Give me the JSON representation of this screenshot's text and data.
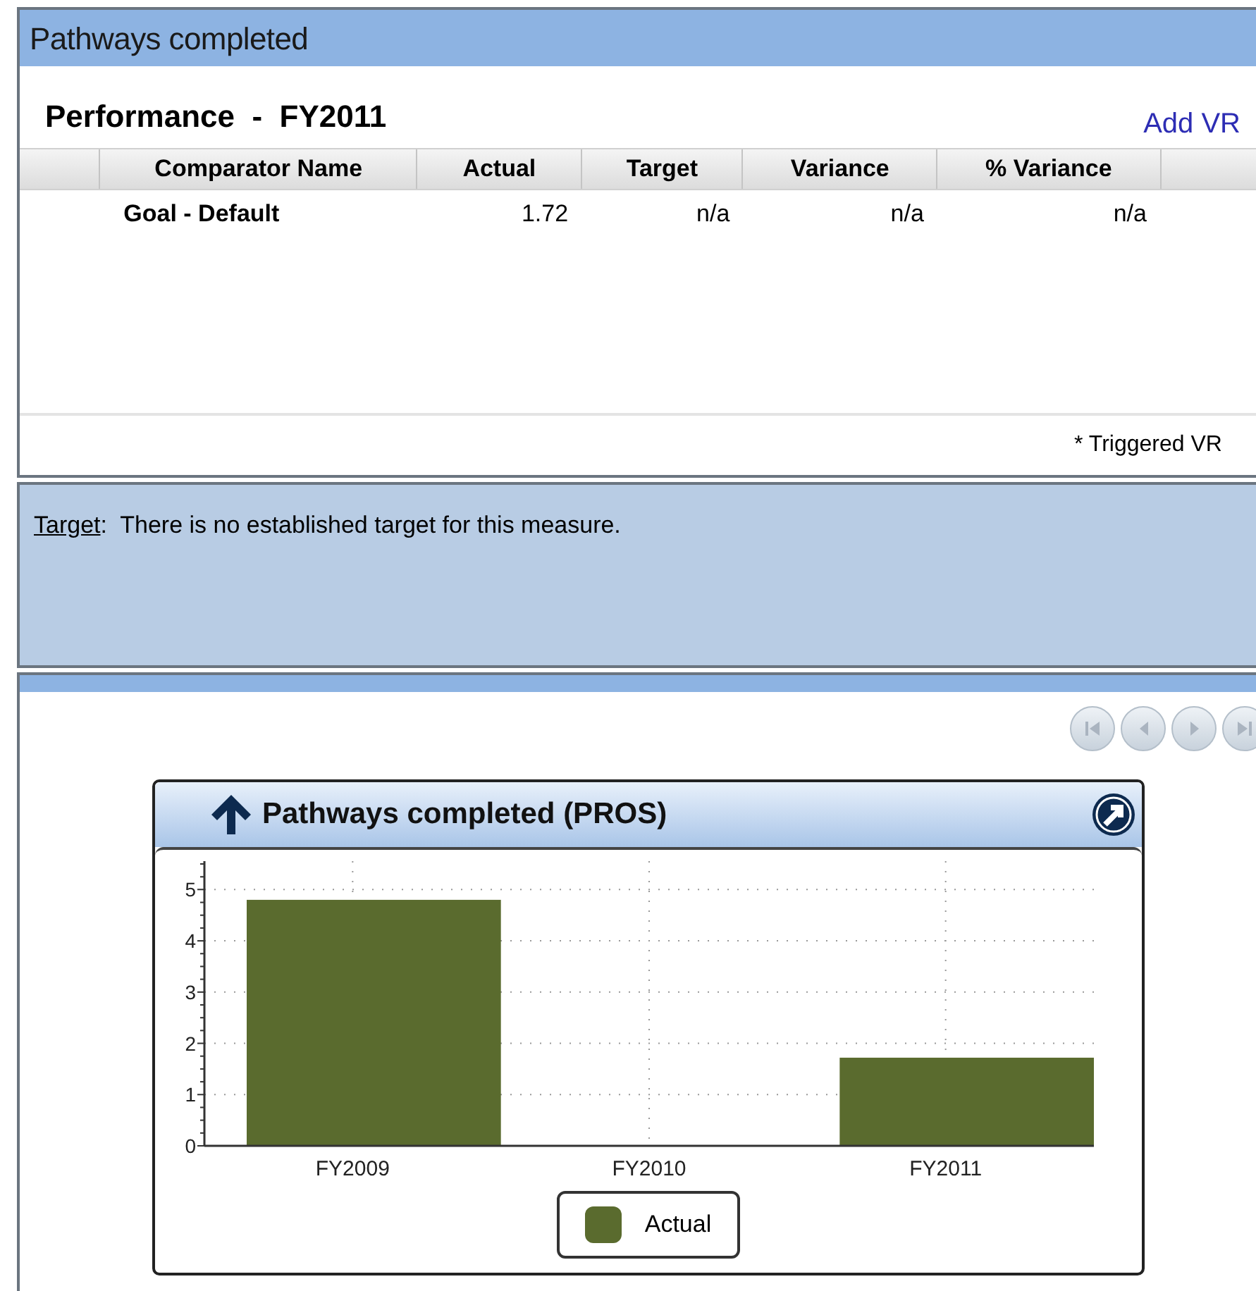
{
  "panel": {
    "title": "Pathways completed"
  },
  "performance": {
    "heading": "Performance  -  FY2011",
    "link": "Add VR"
  },
  "table": {
    "columns": [
      "",
      "Comparator Name",
      "Actual",
      "Target",
      "Variance",
      "% Variance",
      ""
    ],
    "rows": [
      {
        "cells": [
          "",
          "Goal - Default",
          "1.72",
          "n/a",
          "n/a",
          "n/a",
          ""
        ]
      }
    ],
    "footnote": "* Triggered VR"
  },
  "target_note": {
    "label": "Target",
    "text": ":  There is no established target for this measure."
  },
  "pager": [
    {
      "kind": "first"
    },
    {
      "kind": "prev"
    },
    {
      "kind": "next"
    },
    {
      "kind": "last"
    }
  ],
  "chart_card": {
    "title": "Pathways completed (PROS)",
    "chart_data": {
      "type": "bar",
      "categories": [
        "FY2009",
        "FY2010",
        "FY2011"
      ],
      "series": [
        {
          "name": "Actual",
          "color": "#5a6b2e",
          "values": [
            4.8,
            null,
            1.72
          ]
        }
      ],
      "ylim": [
        0,
        5.5
      ],
      "grid": true,
      "yticks": [
        0,
        1,
        2,
        3,
        4,
        5
      ]
    }
  }
}
